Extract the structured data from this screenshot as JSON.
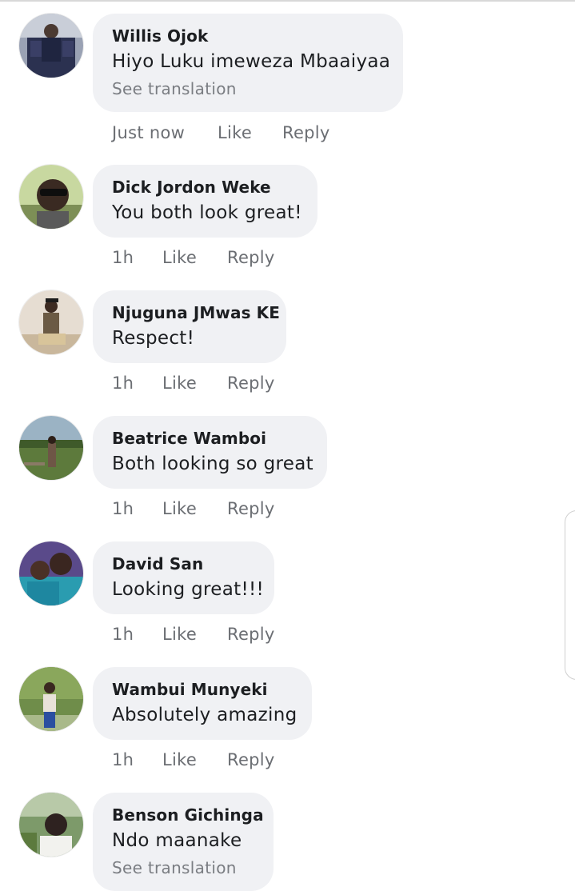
{
  "comments": [
    {
      "author": "Willis Ojok",
      "text": "Hiyo Luku imeweza Mbaaiyaa",
      "see_translation": "See translation",
      "time": "Just now",
      "like": "Like",
      "reply": "Reply"
    },
    {
      "author": "Dick Jordon Weke",
      "text": "You both look great!",
      "time": "1h",
      "like": "Like",
      "reply": "Reply"
    },
    {
      "author": "Njuguna JMwas KE",
      "text": "Respect!",
      "time": "1h",
      "like": "Like",
      "reply": "Reply"
    },
    {
      "author": "Beatrice Wamboi",
      "text": "Both looking so great",
      "time": "1h",
      "like": "Like",
      "reply": "Reply"
    },
    {
      "author": "David San",
      "text": "Looking great!!!",
      "time": "1h",
      "like": "Like",
      "reply": "Reply"
    },
    {
      "author": "Wambui Munyeki",
      "text": "Absolutely amazing",
      "time": "1h",
      "like": "Like",
      "reply": "Reply"
    },
    {
      "author": "Benson Gichinga",
      "text": "Ndo maanake",
      "see_translation": "See translation"
    }
  ],
  "colors": {
    "bubble_bg": "#f0f1f4",
    "author_text": "#1c1e21",
    "meta_text": "#6b6e73"
  }
}
